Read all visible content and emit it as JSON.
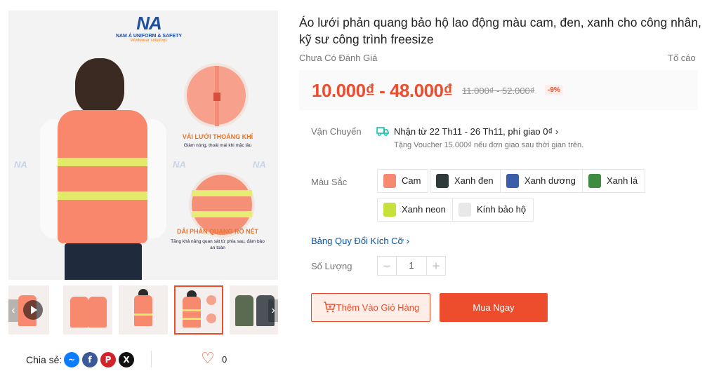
{
  "gallery": {
    "brand_name": "NA",
    "brand_line": "NAM Á UNIFORM & SAFETY",
    "brand_tagline": "Workwear solutions",
    "feature_1_title": "VẢI LƯỚI THOÁNG KHÍ",
    "feature_1_text": "Giảm nóng, thoải mái khi mặc lâu",
    "feature_2_title": "DẢI PHẢN QUANG RÕ NÉT",
    "feature_2_text": "Tăng khả năng quan sát từ phía sau, đảm bảo an toàn",
    "watermark": "NA",
    "selected_thumbnail": 3,
    "thumbnail_count": 5
  },
  "share": {
    "label": "Chia sẻ:",
    "networks": [
      "messenger-icon",
      "facebook-icon",
      "pinterest-icon",
      "x-icon"
    ],
    "likes": "0"
  },
  "product": {
    "title": "Áo lưới phản quang bảo hộ lao động màu cam, đen, xanh cho công nhân, kỹ sư công trình freesize",
    "rating_text": "Chưa Có Đánh Giá",
    "report_text": "Tố cáo",
    "price_range": "10.000₫ - 48.000₫",
    "original_price": "11.000₫ - 52.000₫",
    "discount": "-9%"
  },
  "shipping": {
    "label": "Vận Chuyển",
    "main": "Nhận từ 22 Th11 - 26 Th11, phí giao 0₫",
    "voucher": "Tặng Voucher 15.000₫ nếu đơn giao sau thời gian trên."
  },
  "color": {
    "label": "Màu Sắc",
    "options": [
      "Cam",
      "Xanh đen",
      "Xanh dương",
      "Xanh lá",
      "Xanh neon",
      "Kính bảo hộ"
    ],
    "swatch_colors": [
      "#f58a70",
      "#2f3a3a",
      "#3a5ea8",
      "#3f8b3f",
      "#c7e03a",
      "#e8e8e8"
    ]
  },
  "size_chart_link": "Bảng Quy Đổi Kích Cỡ",
  "quantity": {
    "label": "Số Lượng",
    "value": "1",
    "minus": "−",
    "plus": "+"
  },
  "actions": {
    "add_to_cart": "Thêm Vào Giỏ Hàng",
    "buy_now": "Mua Ngay"
  },
  "colors": {
    "accent": "#ee4d2d",
    "link": "#0055aa"
  }
}
